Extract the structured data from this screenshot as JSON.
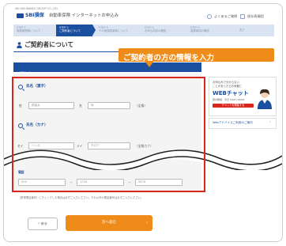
{
  "header": {
    "top_caption": "SBI INSURANCE GROUP CO.,LTD.",
    "brand": "SBI損保",
    "service_title": "自動車保険 インターネットお申込み",
    "help_link": "よくあるご質問",
    "save_link": "保存再開用"
  },
  "steps": [
    {
      "num": "STEP 1",
      "label": "保険期間等について"
    },
    {
      "num": "STEP 2",
      "label": "ご契約者について"
    },
    {
      "num": "STEP 3",
      "label": "その他保険者等について"
    },
    {
      "num": "STEP 4",
      "label": "お申込内容の確認"
    },
    {
      "num": "STEP 5",
      "label": "重要事項の確認"
    },
    {
      "num": "",
      "label": "完了"
    }
  ],
  "page": {
    "title": "ご契約者について"
  },
  "form": {
    "section_label": "ご契約者",
    "name_kanji_label": "氏名（漢字）",
    "sei_label": "姓",
    "sei_value": "損保太",
    "mei_label": "名",
    "mei_value": "郎",
    "name_kanji_hint": "（全角）",
    "name_kana_label": "氏名（カナ）",
    "sei_kana_label": "セイ",
    "sei_kana_value": "ソンポ",
    "mei_kana_label": "メイ",
    "mei_kana_value": "タロウ",
    "name_kana_hint": "（全角カナ）",
    "phone_label": "電話",
    "phone_part1": "090",
    "phone_part2": "1234",
    "phone_part3": "5678",
    "phone_note": "［携帯電話番号］にチェックした場合は必ずご入力ください。それ以外の電話番号は必ずご入力ください。"
  },
  "callout": {
    "text": "ご契約者の方の情報を入力"
  },
  "sidebar": {
    "chat_line1": "お申込みで分からない",
    "chat_line2": "ことがあったらお気軽に",
    "chat_title": "WEBチャット",
    "chat_hours": "受付時間：平日 9:00〜18:00",
    "chat_button": "チャットを開始する",
    "faq_link": "Webアドバイスご利用のご案内"
  },
  "footer": {
    "back_label": "戻る",
    "next_label": "次へ進む"
  },
  "colors": {
    "brand_blue": "#1b4fa0",
    "accent_orange": "#ef8c19",
    "highlight_red": "#d9261c"
  }
}
